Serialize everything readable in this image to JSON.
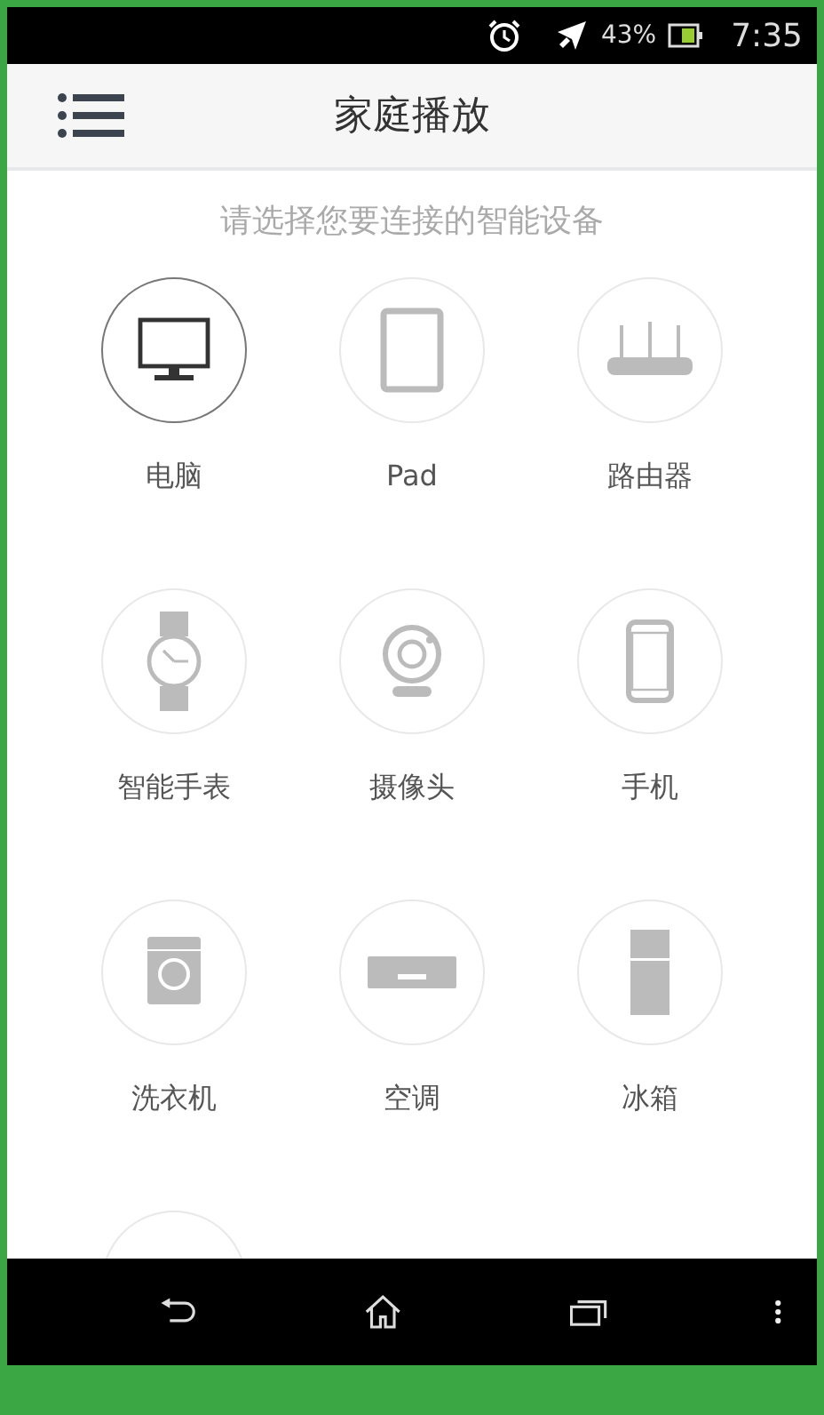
{
  "status_bar": {
    "battery_text": "43%",
    "time": "7:35"
  },
  "app_bar": {
    "title": "家庭播放"
  },
  "prompt": "请选择您要连接的智能设备",
  "devices": [
    {
      "kind": "computer",
      "label": "电脑",
      "selected": true
    },
    {
      "kind": "tablet",
      "label": "Pad",
      "selected": false
    },
    {
      "kind": "router",
      "label": "路由器",
      "selected": false
    },
    {
      "kind": "watch",
      "label": "智能手表",
      "selected": false
    },
    {
      "kind": "camera",
      "label": "摄像头",
      "selected": false
    },
    {
      "kind": "phone",
      "label": "手机",
      "selected": false
    },
    {
      "kind": "washer",
      "label": "洗衣机",
      "selected": false
    },
    {
      "kind": "aircon",
      "label": "空调",
      "selected": false
    },
    {
      "kind": "fridge",
      "label": "冰箱",
      "selected": false
    },
    {
      "kind": "partial",
      "selected": false
    }
  ]
}
